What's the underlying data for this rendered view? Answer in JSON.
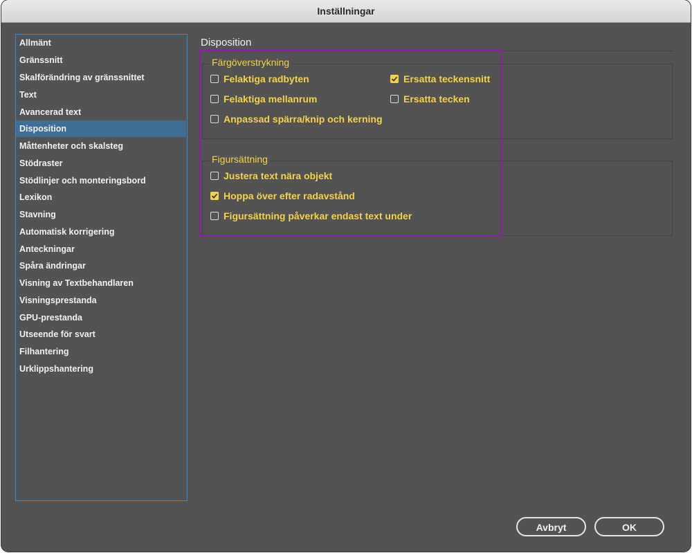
{
  "window": {
    "title": "Inställningar"
  },
  "sidebar": {
    "items": [
      {
        "label": "Allmänt",
        "selected": false
      },
      {
        "label": "Gränssnitt",
        "selected": false
      },
      {
        "label": "Skalförändring av gränssnittet",
        "selected": false
      },
      {
        "label": "Text",
        "selected": false
      },
      {
        "label": "Avancerad text",
        "selected": false
      },
      {
        "label": "Disposition",
        "selected": true
      },
      {
        "label": "Måttenheter och skalsteg",
        "selected": false
      },
      {
        "label": "Stödraster",
        "selected": false
      },
      {
        "label": "Stödlinjer och monteringsbord",
        "selected": false
      },
      {
        "label": "Lexikon",
        "selected": false
      },
      {
        "label": "Stavning",
        "selected": false
      },
      {
        "label": "Automatisk korrigering",
        "selected": false
      },
      {
        "label": "Anteckningar",
        "selected": false
      },
      {
        "label": "Spåra ändringar",
        "selected": false
      },
      {
        "label": "Visning av Textbehandlaren",
        "selected": false
      },
      {
        "label": "Visningsprestanda",
        "selected": false
      },
      {
        "label": "GPU-prestanda",
        "selected": false
      },
      {
        "label": "Utseende för svart",
        "selected": false
      },
      {
        "label": "Filhantering",
        "selected": false
      },
      {
        "label": "Urklippshantering",
        "selected": false
      }
    ]
  },
  "main": {
    "section_title": "Disposition",
    "highlight": {
      "label": "Färgöverstrykning",
      "options": [
        {
          "label": "Felaktiga radbyten",
          "checked": false
        },
        {
          "label": "Ersatta teckensnitt",
          "checked": true
        },
        {
          "label": "Felaktiga mellanrum",
          "checked": false
        },
        {
          "label": "Ersatta tecken",
          "checked": false
        },
        {
          "label": "Anpassad spärra/knip och kerning",
          "checked": false
        }
      ]
    },
    "text_wrap": {
      "label": "Figursättning",
      "options": [
        {
          "label": "Justera text nära objekt",
          "checked": false
        },
        {
          "label": "Hoppa över efter radavstånd",
          "checked": true
        },
        {
          "label": "Figursättning påverkar endast text under",
          "checked": false
        }
      ]
    }
  },
  "buttons": {
    "cancel": "Avbryt",
    "ok": "OK"
  },
  "colors": {
    "accent_text": "#f3d148",
    "selection": "#3f6e96",
    "focus_border": "#2c8fd6",
    "annotation_box": "#8e1fa6"
  }
}
